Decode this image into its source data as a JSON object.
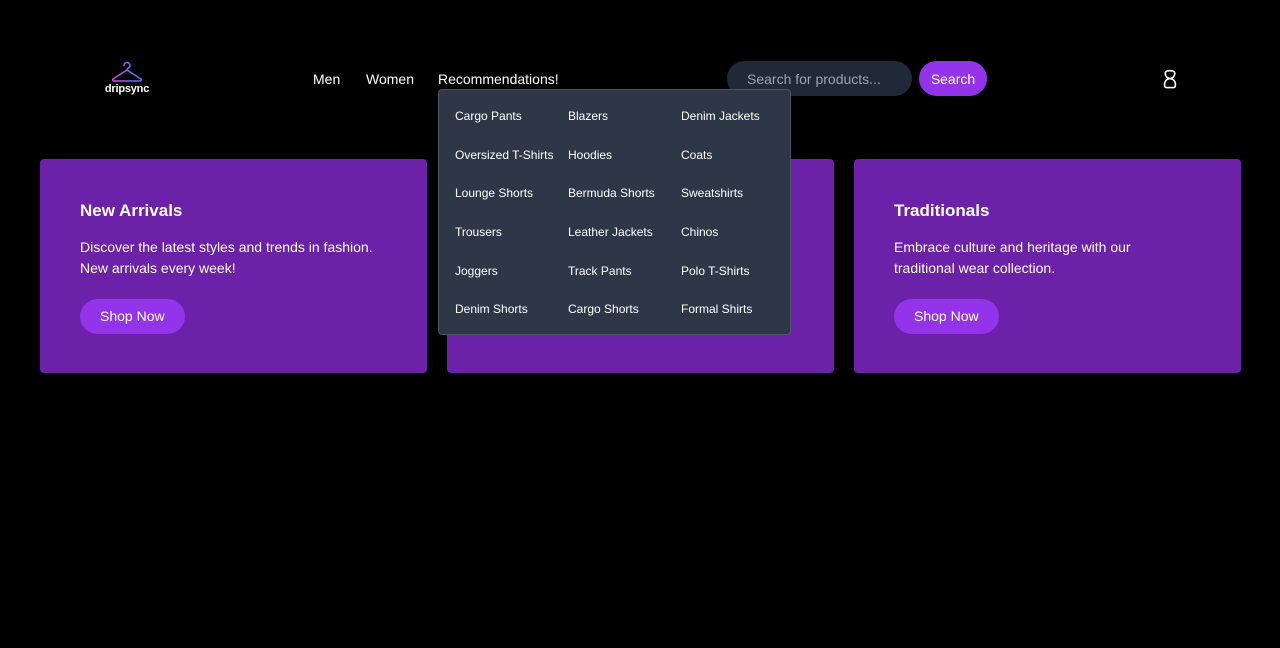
{
  "brand": {
    "name": "dripsync",
    "logo_icon": "hanger-icon",
    "logo_gradient": [
      "#d946ef",
      "#3b82f6"
    ]
  },
  "nav": {
    "men": "Men",
    "women": "Women",
    "recommendations": "Recommendations!"
  },
  "search": {
    "placeholder": "Search for products...",
    "value": "",
    "button_label": "Search"
  },
  "user_icon": "user-icon",
  "dropdown": {
    "items": [
      "Cargo Pants",
      "Blazers",
      "Denim Jackets",
      "Oversized T-Shirts",
      "Hoodies",
      "Coats",
      "Lounge Shorts",
      "Bermuda Shorts",
      "Sweatshirts",
      "Trousers",
      "Leather Jackets",
      "Chinos",
      "Joggers",
      "Track Pants",
      "Polo T-Shirts",
      "Denim Shorts",
      "Cargo Shorts",
      "Formal Shirts"
    ]
  },
  "cards": [
    {
      "title": "New Arrivals",
      "description": "Discover the latest styles and trends in fashion. New arrivals every week!",
      "button": "Shop Now"
    },
    {
      "title": "",
      "description": "",
      "button": ""
    },
    {
      "title": "Traditionals",
      "description": "Embrace culture and heritage with our traditional wear collection.",
      "button": "Shop Now"
    }
  ],
  "colors": {
    "background": "#000000",
    "card": "#6b21a8",
    "accent": "#9333ea",
    "dropdown": "#2d3748",
    "search_bg": "#1f2937"
  }
}
